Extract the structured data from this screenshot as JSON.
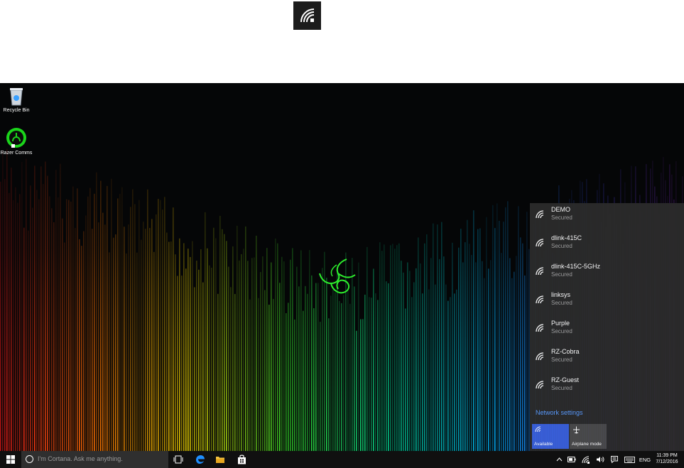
{
  "desktop": {
    "icons": [
      {
        "label": "Recycle Bin",
        "icon": "recycle-bin-icon"
      },
      {
        "label": "Razer Comms",
        "icon": "razer-comms-icon"
      }
    ]
  },
  "wifi_panel": {
    "networks": [
      {
        "name": "DEMO",
        "status": "Secured"
      },
      {
        "name": "dlink-415C",
        "status": "Secured"
      },
      {
        "name": "dlink-415C-5GHz",
        "status": "Secured"
      },
      {
        "name": "linksys",
        "status": "Secured"
      },
      {
        "name": "Purple",
        "status": "Secured"
      },
      {
        "name": "RZ-Cobra",
        "status": "Secured"
      },
      {
        "name": "RZ-Guest",
        "status": "Secured"
      }
    ],
    "settings_link": "Network settings",
    "tiles": [
      {
        "label": "Available",
        "icon": "wifi-icon",
        "active": true
      },
      {
        "label": "Airplane mode",
        "icon": "airplane-icon",
        "active": false
      }
    ]
  },
  "taskbar": {
    "search_placeholder": "I'm Cortana. Ask me anything.",
    "language": "ENG",
    "time": "11:39 PM",
    "date": "7/12/2016"
  },
  "colors": {
    "accent": "#3a5fd9",
    "link": "#5b9cff",
    "panel": "#2b2b2b",
    "taskbar": "#101010"
  }
}
